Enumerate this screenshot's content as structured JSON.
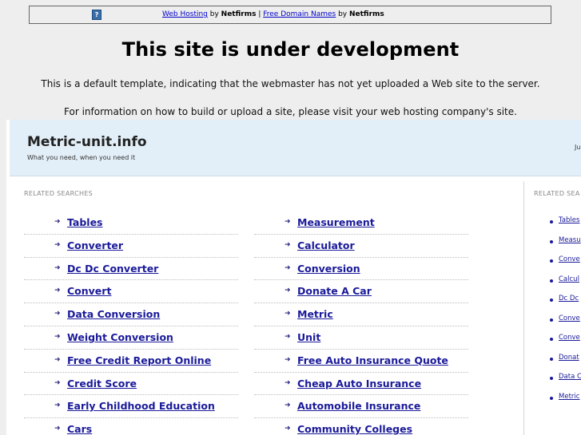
{
  "topbar": {
    "help_icon": "?",
    "link1": "Web Hosting",
    "by1": " by ",
    "brand1": "Netfirms",
    "sep": " | ",
    "link2": "Free Domain Names",
    "by2": " by ",
    "brand2": "Netfirms"
  },
  "headline": "This site is under development",
  "line1": "This is a default template, indicating that the webmaster has not yet uploaded a Web site to the server.",
  "line2": "For information on how to build or upload a site, please visit your web hosting company's site.",
  "site": {
    "title": "Metric-unit.info",
    "subtitle": "What you need, when you need it",
    "date_fragment": "Ju"
  },
  "related": {
    "label": "RELATED SEARCHES",
    "label_right": "RELATED SEA",
    "left": [
      "Tables",
      "Converter",
      "Dc Dc Converter",
      "Convert",
      "Data Conversion",
      "Weight Conversion",
      "Free Credit Report Online",
      "Credit Score",
      "Early Childhood Education",
      "Cars"
    ],
    "middle": [
      "Measurement",
      "Calculator",
      "Conversion",
      "Donate A Car",
      "Metric",
      "Unit",
      "Free Auto Insurance Quote",
      "Cheap Auto Insurance",
      "Automobile Insurance",
      "Community Colleges"
    ],
    "right": [
      "Tables",
      "Measu",
      "Conve",
      "Calcul",
      "Dc Dc",
      "Conve",
      "Conve",
      "Donat",
      "Data C",
      "Metric"
    ]
  },
  "colors": {
    "link": "#1a1a9a",
    "header_bg": "#e3eff8",
    "page_bg": "#eeeeee"
  }
}
